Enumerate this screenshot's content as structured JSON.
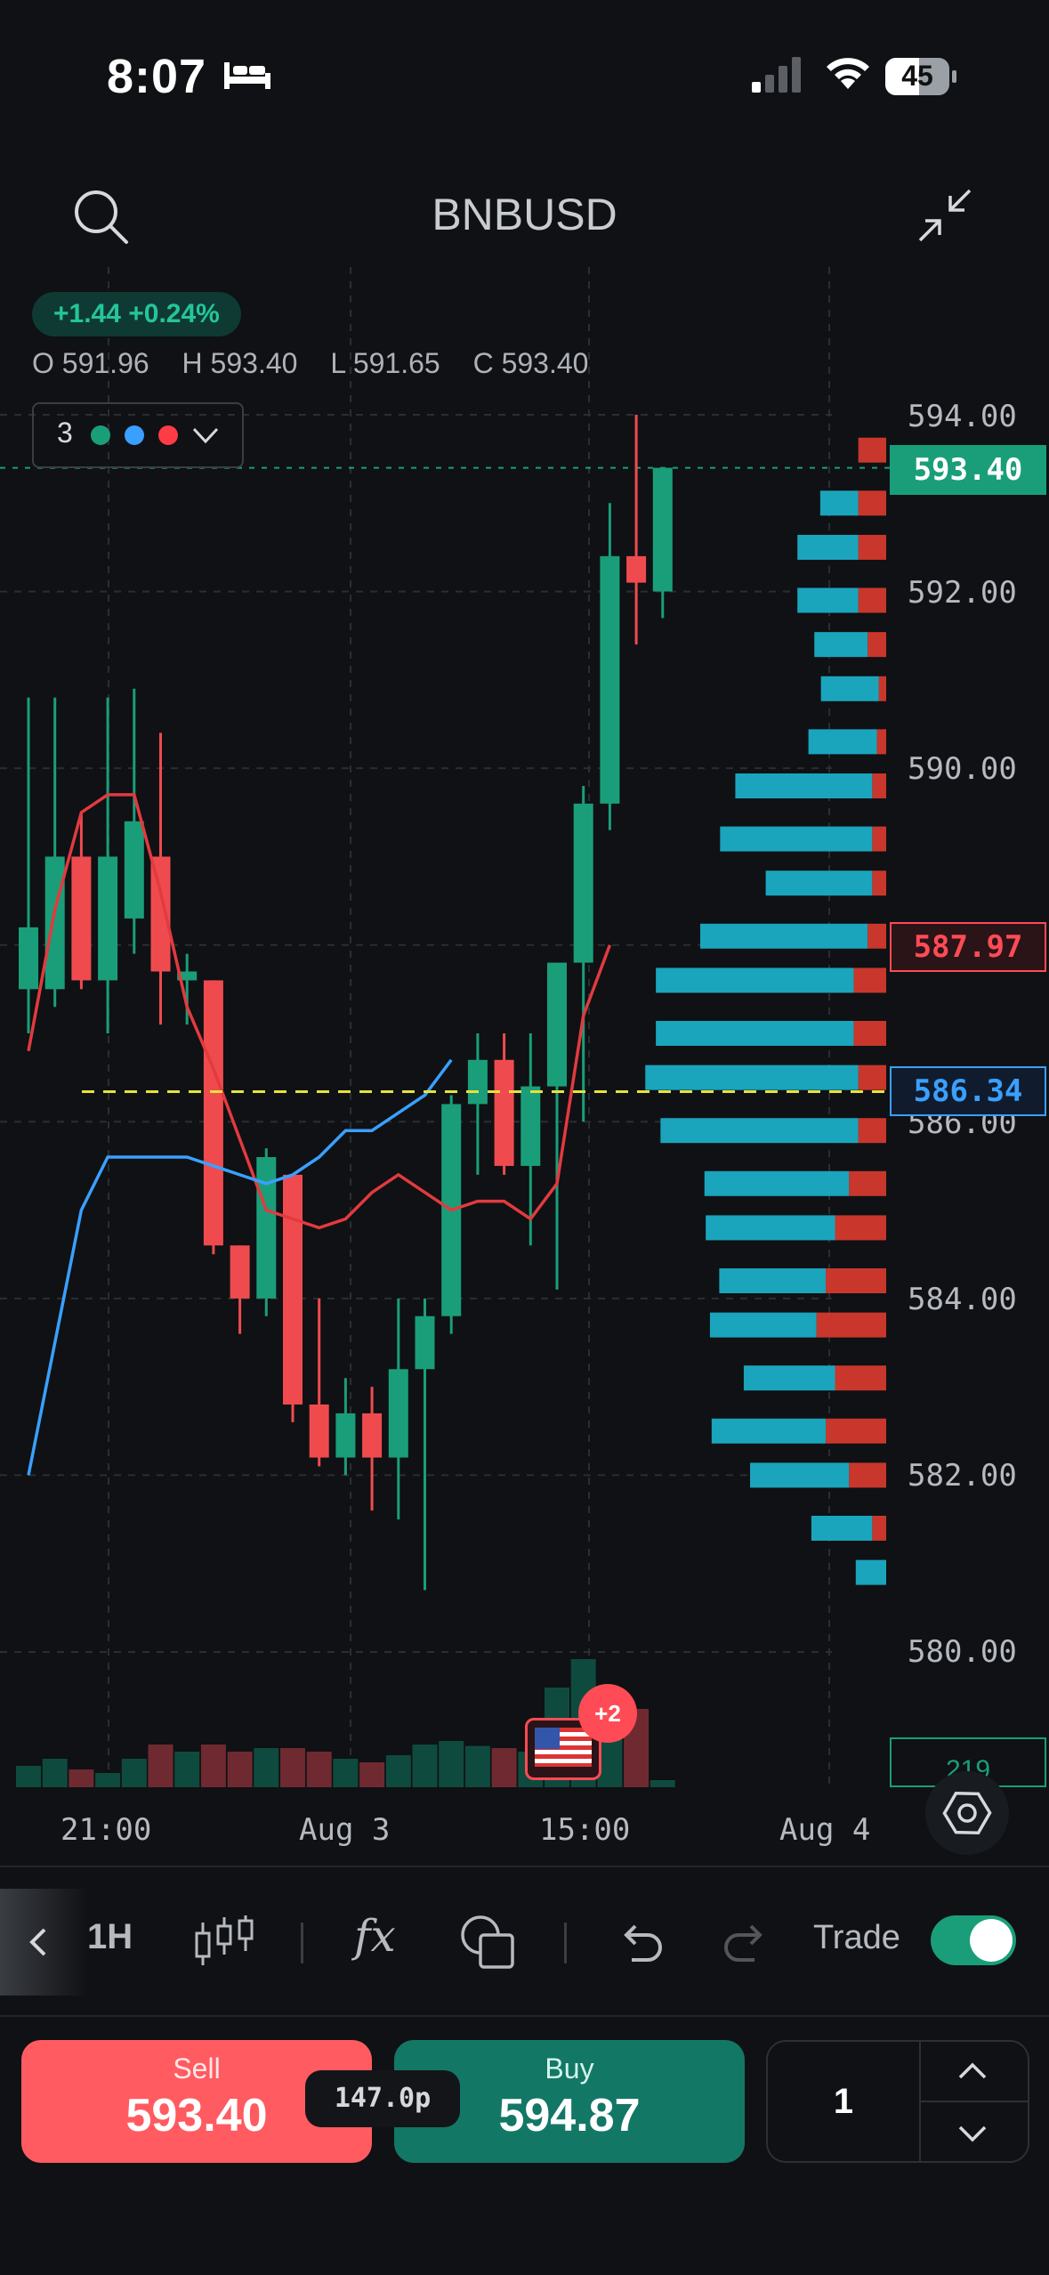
{
  "status_bar": {
    "time": "8:07",
    "battery": "45"
  },
  "header": {
    "symbol": "BNBUSD"
  },
  "quote": {
    "change": "+1.44 +0.24%",
    "open": "O 591.96",
    "high": "H 593.40",
    "low": "L 591.65",
    "close": "C 593.40"
  },
  "indicators": {
    "count": "3",
    "dot_colors": [
      "#1a9e7a",
      "#3aa0ff",
      "#ff3b45"
    ]
  },
  "price_axis": {
    "ticks": [
      "594.00",
      "592.00",
      "590.00",
      "586.00",
      "584.00",
      "582.00",
      "580.00"
    ],
    "last_price": "593.40",
    "red_level": "587.97",
    "blue_level": "586.34",
    "volume_tag": "219"
  },
  "time_axis": {
    "labels": [
      "21:00",
      "Aug 3",
      "15:00",
      "Aug 4"
    ]
  },
  "event_badge": {
    "count": "+2"
  },
  "toolbar": {
    "interval": "1H",
    "fx": "fx",
    "trade_label": "Trade",
    "trade_on": true
  },
  "order": {
    "sell_label": "Sell",
    "sell_price": "593.40",
    "spread": "147.0p",
    "buy_label": "Buy",
    "buy_price": "594.87",
    "quantity": "1"
  },
  "colors": {
    "up": "#1a9e7a",
    "down": "#ef4b4f",
    "accent_blue": "#3aa0ff",
    "dashed_level": "#e6e13a"
  },
  "chart_data": {
    "type": "candlestick",
    "y_range": [
      580,
      594
    ],
    "x_labels": [
      "21:00",
      "Aug 3",
      "15:00",
      "Aug 4"
    ],
    "candles": [
      {
        "o": 587.5,
        "h": 590.8,
        "l": 587.0,
        "c": 588.2
      },
      {
        "o": 587.5,
        "h": 590.8,
        "l": 587.3,
        "c": 589.0
      },
      {
        "o": 589.0,
        "h": 589.5,
        "l": 587.5,
        "c": 587.6
      },
      {
        "o": 587.6,
        "h": 590.8,
        "l": 587.0,
        "c": 589.0
      },
      {
        "o": 588.3,
        "h": 590.9,
        "l": 587.9,
        "c": 589.4
      },
      {
        "o": 589.0,
        "h": 590.4,
        "l": 587.1,
        "c": 587.7
      },
      {
        "o": 587.6,
        "h": 587.9,
        "l": 587.1,
        "c": 587.7
      },
      {
        "o": 587.6,
        "h": 587.6,
        "l": 584.5,
        "c": 584.6
      },
      {
        "o": 584.6,
        "h": 584.6,
        "l": 583.6,
        "c": 584.0
      },
      {
        "o": 584.0,
        "h": 585.7,
        "l": 583.8,
        "c": 585.6
      },
      {
        "o": 585.4,
        "h": 585.4,
        "l": 582.6,
        "c": 582.8
      },
      {
        "o": 582.8,
        "h": 584.0,
        "l": 582.1,
        "c": 582.2
      },
      {
        "o": 582.2,
        "h": 583.1,
        "l": 582.0,
        "c": 582.7
      },
      {
        "o": 582.7,
        "h": 583.0,
        "l": 581.6,
        "c": 582.2
      },
      {
        "o": 582.2,
        "h": 584.0,
        "l": 581.5,
        "c": 583.2
      },
      {
        "o": 583.2,
        "h": 584.0,
        "l": 580.7,
        "c": 583.8
      },
      {
        "o": 583.8,
        "h": 586.3,
        "l": 583.6,
        "c": 586.2
      },
      {
        "o": 586.2,
        "h": 587.0,
        "l": 585.4,
        "c": 586.7
      },
      {
        "o": 586.7,
        "h": 587.0,
        "l": 585.4,
        "c": 585.5
      },
      {
        "o": 585.5,
        "h": 587.0,
        "l": 584.6,
        "c": 586.4
      },
      {
        "o": 586.4,
        "h": 587.7,
        "l": 584.1,
        "c": 587.8
      },
      {
        "o": 587.8,
        "h": 589.8,
        "l": 586.0,
        "c": 589.6
      },
      {
        "o": 589.6,
        "h": 593.0,
        "l": 589.3,
        "c": 592.4
      },
      {
        "o": 592.4,
        "h": 594.0,
        "l": 591.4,
        "c": 592.1
      },
      {
        "o": 592.0,
        "h": 593.4,
        "l": 591.7,
        "c": 593.4
      }
    ],
    "volumes": [
      0.3,
      0.4,
      0.25,
      0.2,
      0.4,
      0.6,
      0.5,
      0.6,
      0.5,
      0.55,
      0.55,
      0.5,
      0.4,
      0.35,
      0.45,
      0.6,
      0.65,
      0.58,
      0.55,
      0.5,
      1.4,
      1.8,
      1.4,
      1.1,
      0.1
    ],
    "ma_red": [
      586.8,
      588.4,
      589.5,
      589.7,
      589.7,
      588.6,
      587.3,
      586.6,
      585.8,
      585.0,
      584.9,
      584.8,
      584.9,
      585.2,
      585.4,
      585.2,
      585.0,
      585.1,
      585.1,
      584.9,
      585.3,
      587.2,
      588.0
    ],
    "ma_blue": [
      582.0,
      583.5,
      585.0,
      585.6,
      585.6,
      585.6,
      585.6,
      585.5,
      585.4,
      585.3,
      585.4,
      585.6,
      585.9,
      585.9,
      586.1,
      586.3,
      586.7
    ],
    "levels": {
      "last": 593.4,
      "red": 587.97,
      "blue": 586.34,
      "dashed": 586.34
    },
    "volume_profile": [
      {
        "p": 593.6,
        "b": 0,
        "r": 30
      },
      {
        "p": 593.0,
        "b": 25,
        "r": 30
      },
      {
        "p": 592.5,
        "b": 40,
        "r": 30
      },
      {
        "p": 591.9,
        "b": 40,
        "r": 30
      },
      {
        "p": 591.4,
        "b": 35,
        "r": 20
      },
      {
        "p": 590.9,
        "b": 38,
        "r": 8
      },
      {
        "p": 590.3,
        "b": 45,
        "r": 10
      },
      {
        "p": 589.8,
        "b": 90,
        "r": 15
      },
      {
        "p": 589.2,
        "b": 100,
        "r": 15
      },
      {
        "p": 588.7,
        "b": 70,
        "r": 15
      },
      {
        "p": 588.1,
        "b": 110,
        "r": 20
      },
      {
        "p": 587.6,
        "b": 130,
        "r": 35
      },
      {
        "p": 587.0,
        "b": 130,
        "r": 35
      },
      {
        "p": 586.5,
        "b": 140,
        "r": 30
      },
      {
        "p": 585.9,
        "b": 130,
        "r": 30
      },
      {
        "p": 585.3,
        "b": 95,
        "r": 40
      },
      {
        "p": 584.8,
        "b": 85,
        "r": 55
      },
      {
        "p": 584.2,
        "b": 70,
        "r": 65
      },
      {
        "p": 583.7,
        "b": 70,
        "r": 75
      },
      {
        "p": 583.1,
        "b": 60,
        "r": 55
      },
      {
        "p": 582.5,
        "b": 75,
        "r": 65
      },
      {
        "p": 582.0,
        "b": 65,
        "r": 40
      },
      {
        "p": 581.4,
        "b": 40,
        "r": 15
      },
      {
        "p": 580.9,
        "b": 20,
        "r": 0
      }
    ]
  }
}
